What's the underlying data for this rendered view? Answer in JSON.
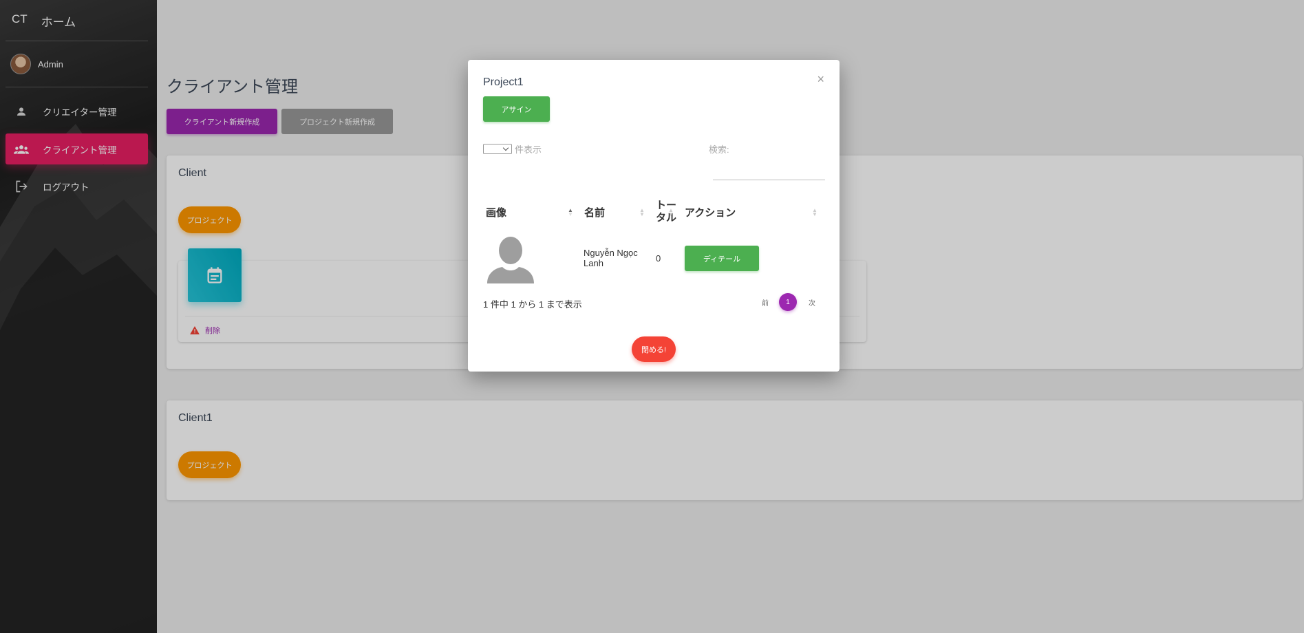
{
  "sidebar": {
    "brand_short": "CT",
    "brand_home": "ホーム",
    "user_name": "Admin",
    "items": [
      {
        "label": "クリエイター管理",
        "icon": "person-icon"
      },
      {
        "label": "クライアント管理",
        "icon": "group-icon",
        "active": true
      },
      {
        "label": "ログアウト",
        "icon": "logout-icon"
      }
    ]
  },
  "main": {
    "title": "クライアント管理",
    "new_client_button": "クライアント新規作成",
    "new_project_button": "プロジェクト新規作成",
    "clients": [
      {
        "name": "Client",
        "project_button": "プロジェクト",
        "delete_label": "削除"
      },
      {
        "name": "Client1",
        "project_button": "プロジェクト"
      }
    ]
  },
  "modal": {
    "title": "Project1",
    "close": "×",
    "assign_button": "アサイン",
    "length_suffix": "件表示",
    "search_label": "検索:",
    "columns": [
      "画像",
      "名前",
      "トータル",
      "アクション"
    ],
    "rows": [
      {
        "name": "Nguyễn Ngọc Lanh",
        "total": "0",
        "action": "ディテール"
      }
    ],
    "info": "1 件中 1 から 1 まで表示",
    "pagination": {
      "prev": "前",
      "current": "1",
      "next": "次"
    },
    "close_button": "閉める!"
  },
  "colors": {
    "accent_purple": "#9c27b0",
    "active_pink": "#e91e63",
    "orange": "#ff9800",
    "green": "#4caf50",
    "red": "#f44336",
    "cyan": "#00acc1"
  }
}
